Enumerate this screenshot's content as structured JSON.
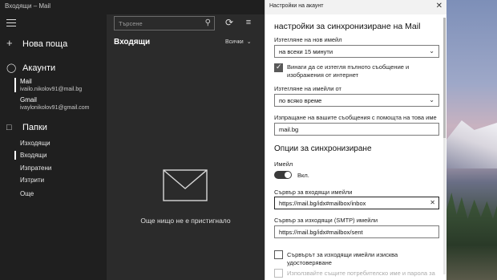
{
  "window": {
    "title": "Входящи – Mail"
  },
  "sidebar": {
    "new_mail": "Нова поща",
    "accounts_heading": "Акаунти",
    "accounts": [
      {
        "name": "Mail",
        "email": "ivailo.nikolov91@mail.bg"
      },
      {
        "name": "Gmail",
        "email": "ivaylonikolov91@gmail.com"
      }
    ],
    "folders_heading": "Папки",
    "folders": [
      "Изходящи",
      "Входящи",
      "Изпратени",
      "Изтрити",
      "Още"
    ]
  },
  "middle": {
    "search_placeholder": "Търсене",
    "title": "Входящи",
    "filter_value": "Всички",
    "empty_message": "Още нищо не е пристигнало"
  },
  "settings": {
    "window_title": "Настройки на акаунт",
    "heading": "настройки за синхронизиране на Mail",
    "download_new_label": "Изтегляне на нов имейл",
    "download_new_value": "на всеки 15 минути",
    "full_message_checkbox": "Винаги да се изтегля пълното съобщение и изображения от интернет",
    "download_from_label": "Изтегляне на имейли от",
    "download_from_value": "по всяко време",
    "send_name_label": "Изпращане на вашите съобщения с помощта на това име",
    "send_name_value": "mail.bg",
    "sync_options_heading": "Опции за синхронизиране",
    "email_label": "Имейл",
    "email_toggle": "Вкл.",
    "incoming_server_label": "Сървър за входящи имейли",
    "incoming_server_value": "https://mail.bg/idx#mailbox/inbox",
    "outgoing_server_label": "Сървър за изходящи (SMTP) имейли",
    "outgoing_server_value": "https://mail.bg/idx#mailbox/sent",
    "smtp_auth_checkbox": "Сървърът за изходящи имейли изисква удостоверяване",
    "same_credentials_checkbox": "Използвайте същите потребителско име и парола за"
  },
  "icons": {
    "hamburger": "hamburger-icon",
    "sync": "sync-icon",
    "filter": "filter-icon",
    "envelope": "envelope-icon"
  }
}
